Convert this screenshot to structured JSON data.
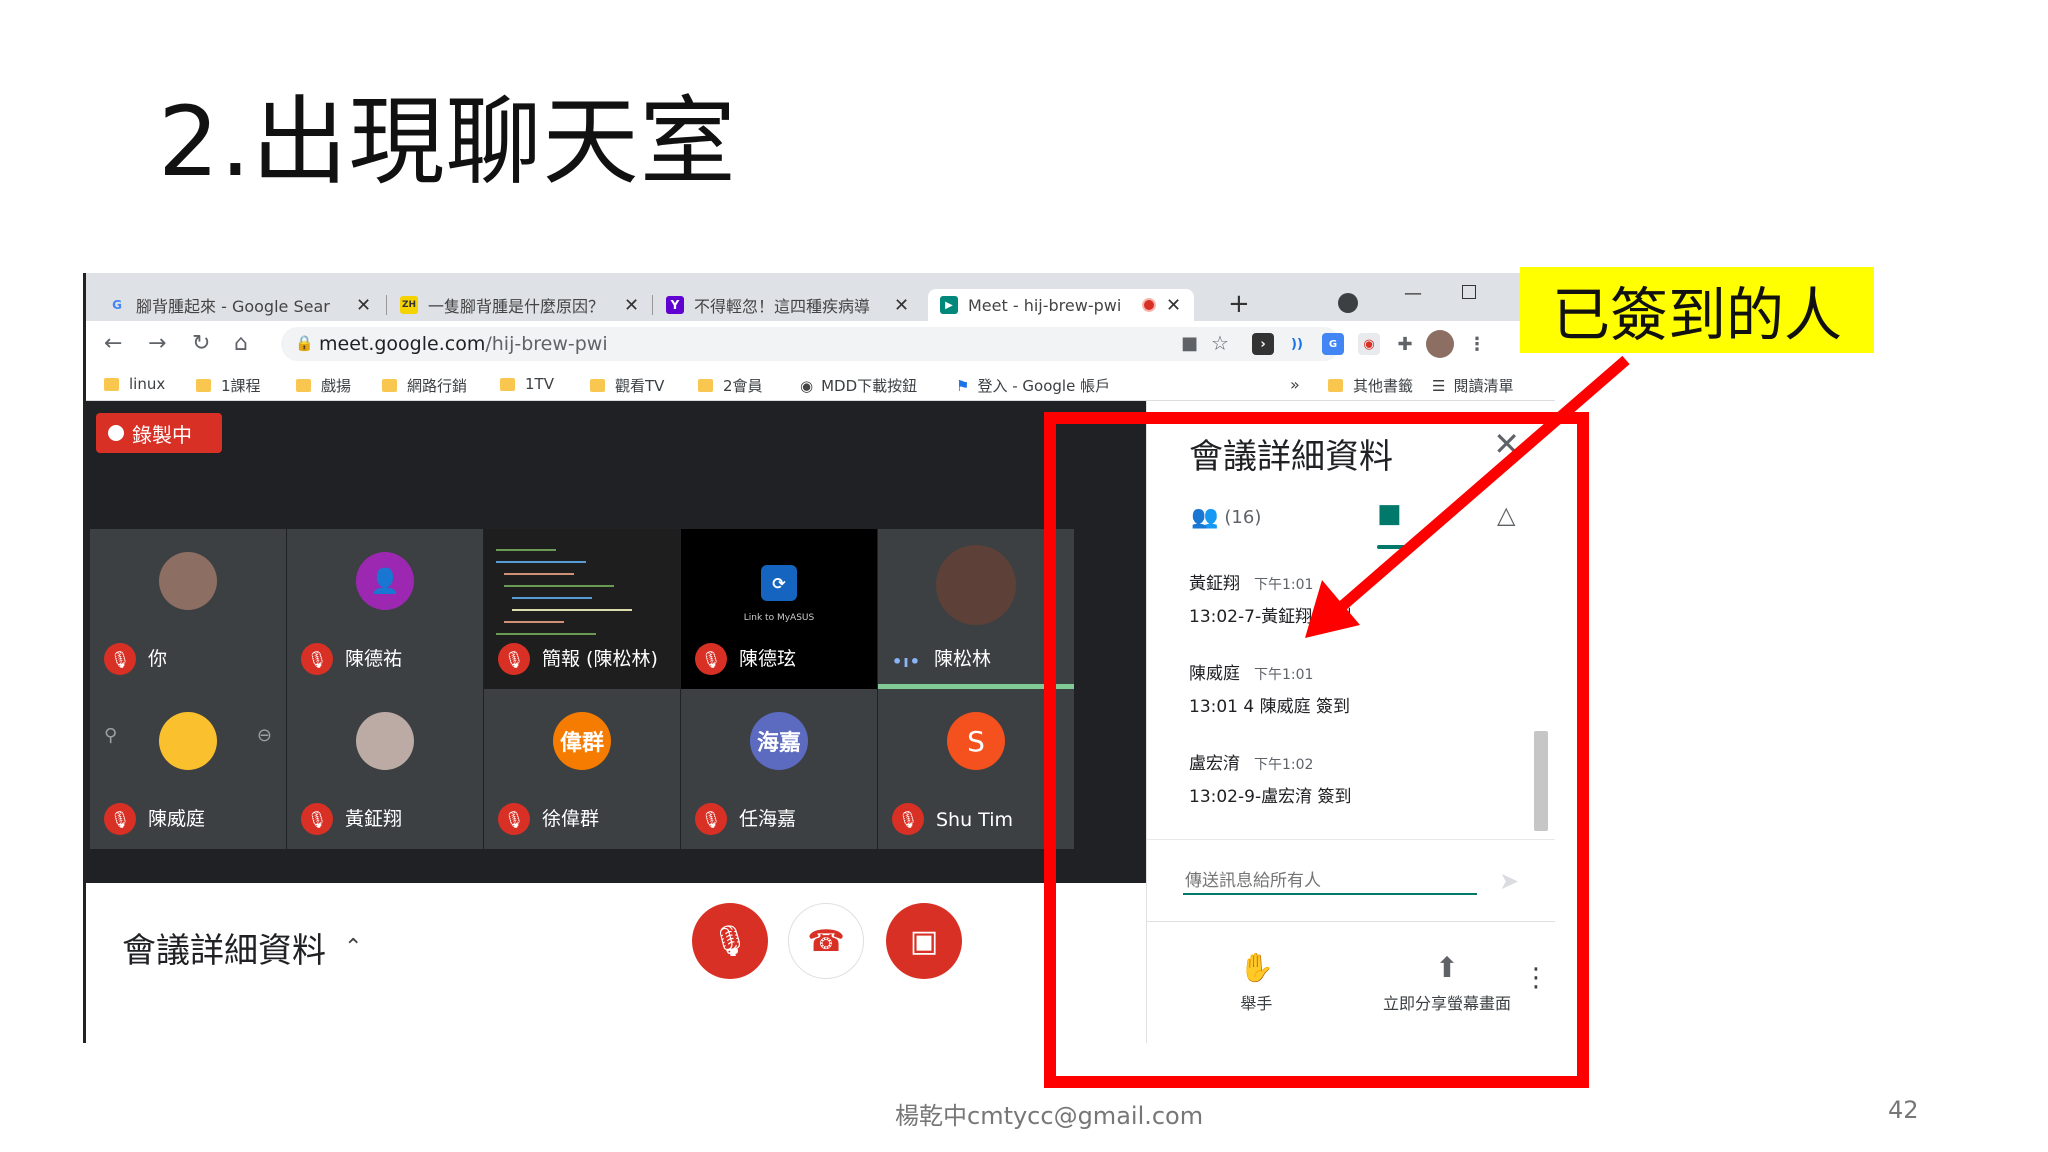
{
  "slide": {
    "title": "2.出現聊天室",
    "callout": "已簽到的人",
    "footer_email": "楊乾中cmtycc@gmail.com",
    "page_number": "42"
  },
  "browser": {
    "tabs": [
      {
        "icon": "google-icon",
        "favicon": "G",
        "label": "腳背腫起來 - Google Sear",
        "close": "✕"
      },
      {
        "icon": "zh-icon",
        "favicon": "ZH",
        "label": "一隻腳背腫是什麼原因？",
        "close": "✕"
      },
      {
        "icon": "yahoo-icon",
        "favicon": "Y",
        "label": "不得輕忽！這四種疾病導",
        "close": "✕"
      },
      {
        "icon": "meet-icon",
        "favicon": "▶",
        "label": "Meet - hij-brew-pwi",
        "close": "✕",
        "active": true
      }
    ],
    "new_tab": "+",
    "url": "meet.google.com",
    "url_path": "/hij-brew-pwi",
    "bookmarks": [
      {
        "label": "linux"
      },
      {
        "label": "1課程"
      },
      {
        "label": "戲揚"
      },
      {
        "label": "網路行銷"
      },
      {
        "label": "1TV"
      },
      {
        "label": "觀看TV"
      },
      {
        "label": "2會員"
      },
      {
        "label": "MDD下載按鈕"
      },
      {
        "label": "登入 - Google 帳戶"
      }
    ],
    "bookmarks_overflow": "»",
    "bookmarks_right": [
      "其他書籤",
      "閱讀清單"
    ]
  },
  "meet": {
    "recording_label": "錄製中",
    "participants_row1": [
      {
        "name": "你",
        "avatar": "photo",
        "color": "#8d6e63"
      },
      {
        "name": "陳德祐",
        "avatar": "person",
        "color": "#9c27b0"
      },
      {
        "name": "簡報 (陳松林)",
        "avatar": "screen",
        "color": "#1e1e1e"
      },
      {
        "name": "陳德玹",
        "avatar": "link-to-myasus",
        "color": "#000000"
      },
      {
        "name": "陳松林",
        "avatar": "photo",
        "color": "#5d4037",
        "speaking": true
      }
    ],
    "participants_row2": [
      {
        "name": "陳威庭",
        "avatar": "photo",
        "color": "#fbc02d"
      },
      {
        "name": "黃鉦翔",
        "avatar": "photo",
        "color": "#bcaaa4"
      },
      {
        "name": "徐偉群",
        "avatar": "偉群",
        "color": "#f57c00"
      },
      {
        "name": "任海嘉",
        "avatar": "海嘉",
        "color": "#5c6bc0"
      },
      {
        "name": "Shu Tim",
        "avatar": "S",
        "color": "#f4511e"
      }
    ],
    "screen_share_caption": "Link to MyASUS",
    "meeting_details_label": "會議詳細資料",
    "colors": {
      "danger": "#d93025",
      "tile": "#3c4043",
      "stage": "#202124"
    }
  },
  "panel": {
    "title": "會議詳細資料",
    "people_count": "(16)",
    "messages": [
      {
        "sender": "黃鉦翔",
        "time": "下午1:01",
        "text": "13:02-7-黃鉦翔 簽到"
      },
      {
        "sender": "陳威庭",
        "time": "下午1:01",
        "text": "13:01 4 陳威庭 簽到"
      },
      {
        "sender": "盧宏淯",
        "time": "下午1:02",
        "text": "13:02-9-盧宏淯 簽到"
      }
    ],
    "input_placeholder": "傳送訊息給所有人",
    "raise_hand": "舉手",
    "present_now": "立即分享螢幕畫面"
  }
}
